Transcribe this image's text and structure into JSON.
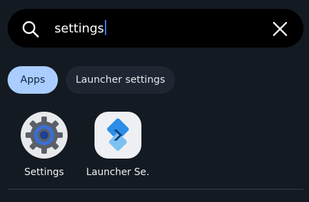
{
  "search": {
    "query": "settings",
    "icon": "search-icon",
    "clear_icon": "close-icon"
  },
  "filters": {
    "apps_label": "Apps",
    "launcher_settings_label": "Launcher settings",
    "selected": "Apps"
  },
  "results": [
    {
      "label": "Settings",
      "icon": "settings-gear-icon"
    },
    {
      "label": "Launcher Se…",
      "icon": "launcher-app-icon"
    }
  ],
  "colors": {
    "background": "#141a22",
    "search_bar": "#000000",
    "chip_selected": "#a9cdff",
    "chip_unselected": "#1f2631",
    "caret": "#3d7bff",
    "launcher_accent": "#2b8de6"
  }
}
